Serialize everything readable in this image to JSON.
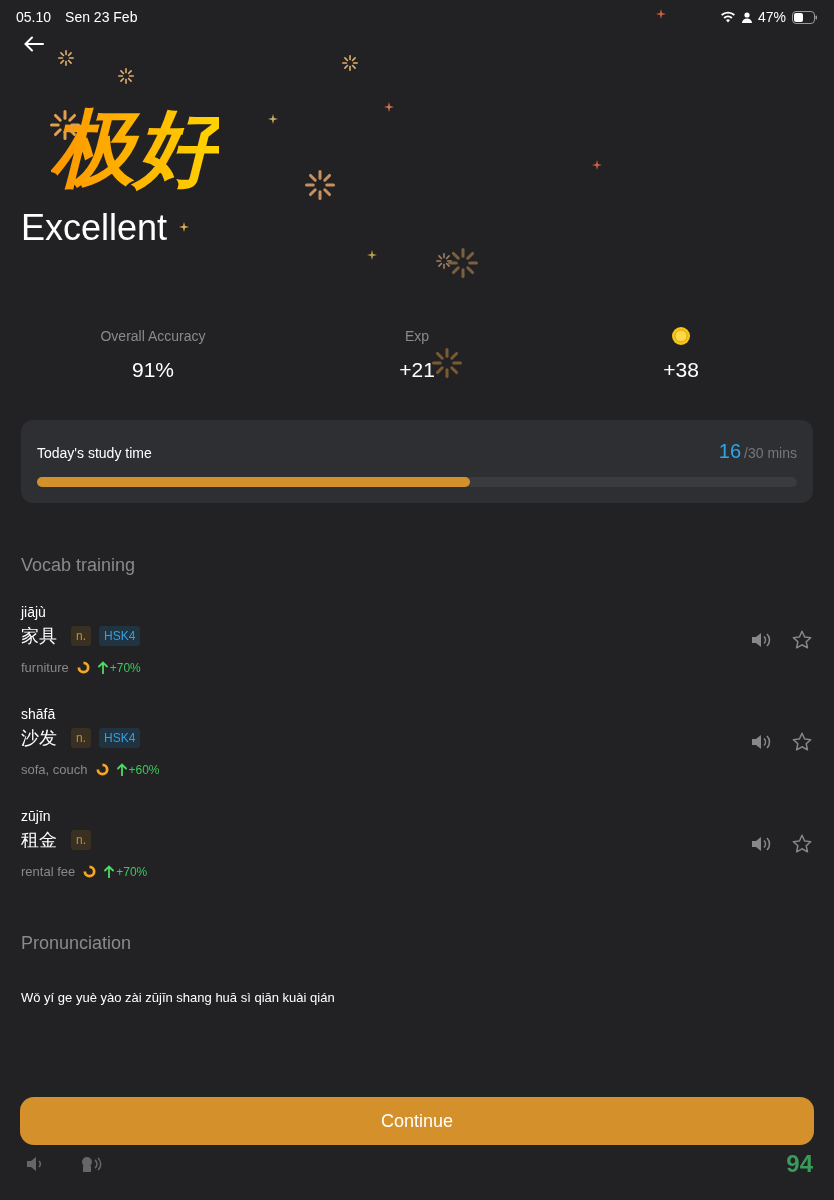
{
  "status_bar": {
    "time": "05.10",
    "date": "Sen 23 Feb",
    "battery": "47%"
  },
  "result": {
    "headline_cn": "极好",
    "headline": "Excellent"
  },
  "stats": [
    {
      "kind": "label",
      "label": "Overall Accuracy",
      "value": "91%"
    },
    {
      "kind": "label",
      "label": "Exp",
      "value": "+21"
    },
    {
      "kind": "coin",
      "value": "+38"
    }
  ],
  "study_time": {
    "label": "Today's study time",
    "minutes": "16",
    "goal": "/30 mins",
    "level": 0.57
  },
  "vocab": {
    "title": "Vocab training",
    "items": [
      {
        "pinyin": "jiājù",
        "hanzi": "家具",
        "tags": [
          {
            "kind": "pos",
            "label": "n."
          },
          {
            "kind": "hsk",
            "label": "HSK4"
          }
        ],
        "meaning": "furniture",
        "change": "+70%",
        "starred": false
      },
      {
        "pinyin": "shāfā",
        "hanzi": "沙发",
        "tags": [
          {
            "kind": "pos",
            "label": "n."
          },
          {
            "kind": "hsk",
            "label": "HSK4"
          }
        ],
        "meaning": "sofa, couch",
        "change": "+60%",
        "starred": false
      },
      {
        "pinyin": "zūjīn",
        "hanzi": "租金",
        "tags": [
          {
            "kind": "pos",
            "label": "n."
          }
        ],
        "meaning": "rental fee",
        "change": "+70%",
        "starred": false
      }
    ]
  },
  "pronunciation": {
    "title": "Pronunciation",
    "sentence": "Wǒ yí ge yuè yào zài zūjīn shang huā sì qiān kuài qián",
    "score": "94"
  },
  "continue_button": "Continue"
}
